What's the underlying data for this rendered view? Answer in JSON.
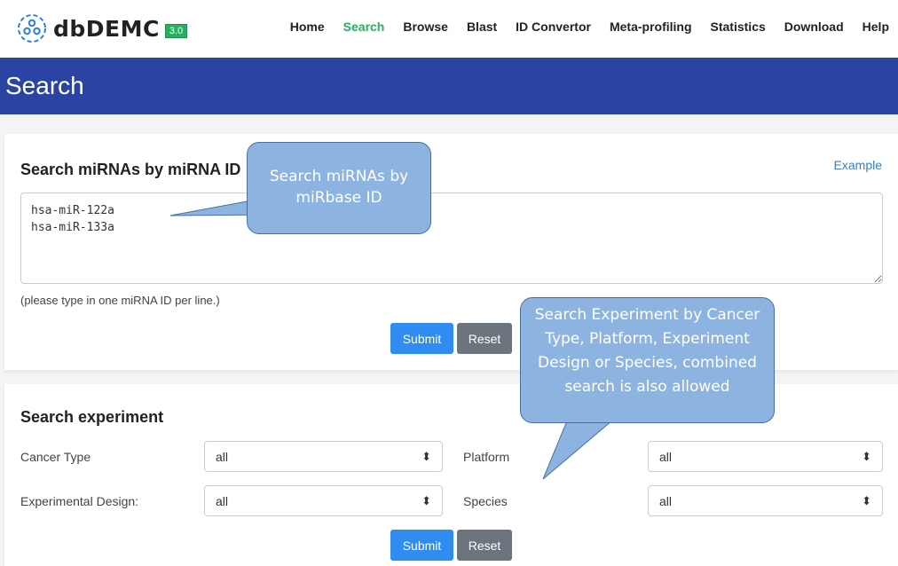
{
  "app": {
    "name": "dbDEMC",
    "version": "3.0",
    "brand_color": "#27ae60"
  },
  "nav": {
    "items": [
      {
        "label": "Home",
        "active": false
      },
      {
        "label": "Search",
        "active": true
      },
      {
        "label": "Browse",
        "active": false
      },
      {
        "label": "Blast",
        "active": false
      },
      {
        "label": "ID Convertor",
        "active": false
      },
      {
        "label": "Meta-profiling",
        "active": false
      },
      {
        "label": "Statistics",
        "active": false
      },
      {
        "label": "Download",
        "active": false
      },
      {
        "label": "Help",
        "active": false
      }
    ]
  },
  "banner": {
    "title": "Search",
    "color": "#2b44a3"
  },
  "mirna_search": {
    "title": "Search miRNAs by miRNA ID",
    "example_label": "Example",
    "textarea_value": "hsa-miR-122a\nhsa-miR-133a",
    "hint": "(please type in one miRNA ID per line.)",
    "submit_label": "Submit",
    "reset_label": "Reset"
  },
  "experiment_search": {
    "title": "Search experiment",
    "cancer_type_label": "Cancer Type",
    "cancer_type_value": "all",
    "platform_label": "Platform",
    "platform_value": "all",
    "design_label": "Experimental Design:",
    "design_value": "all",
    "species_label": "Species",
    "species_value": "all",
    "submit_label": "Submit",
    "reset_label": "Reset"
  },
  "callouts": {
    "mirna": "Search miRNAs by miRbase ID",
    "experiment": "Search Experiment by Cancer Type, Platform, Experiment Design or Species, combined search is also allowed"
  },
  "icons": {
    "logo": "molecule-icon",
    "select_arrow": "sort-arrows-icon"
  }
}
